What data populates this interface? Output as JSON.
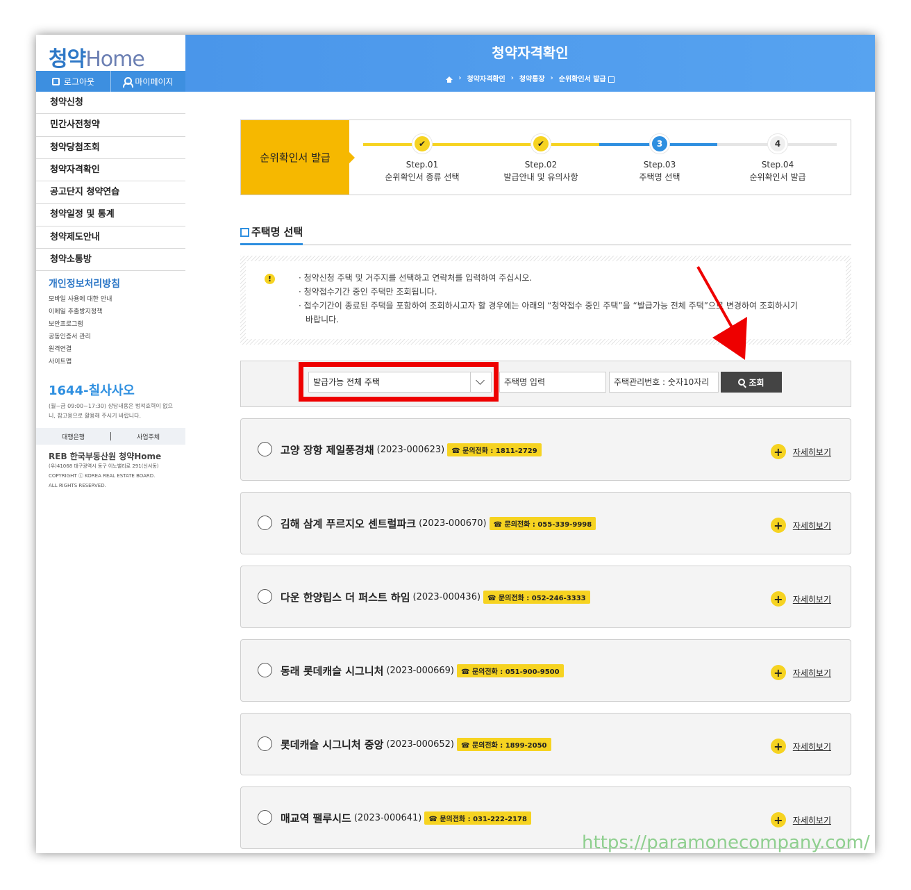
{
  "sidebar": {
    "logo_a": "청약",
    "logo_b": "Home",
    "logout": "로그아웃",
    "mypage": "마이페이지",
    "menu": [
      "청약신청",
      "민간사전청약",
      "청약당첨조회",
      "청약자격확인",
      "공고단지 청약연습",
      "청약일정 및 통계",
      "청약제도안내",
      "청약소통방"
    ],
    "privacy_title": "개인정보처리방침",
    "links": [
      "모바일 사용에 대한 안내",
      "이메일 추출방지정책",
      "보안프로그램",
      "공동인증서 관리",
      "원격연결",
      "사이트맵"
    ],
    "phone": "1644-칠사사오",
    "phone_note": "(월~금 09:00~17:30) 상담내용은 법적효력이 없으니, 참고용으로 활용해 주시기 바랍니다.",
    "bank": "대행은행",
    "business": "사업주체",
    "footer_logo": "REB 한국부동산원 청약Home",
    "footer_address": "(우)41068 대구광역시 동구 이노밸리로 291(신서동)",
    "footer_copy": "COPYRIGHT ⓒ KOREA REAL ESTATE BOARD.",
    "footer_rights": "ALL RIGHTS RESERVED."
  },
  "header": {
    "title": "청약자격확인",
    "crumbs": [
      "청약자격확인",
      "청약통장",
      "순위확인서 발급"
    ]
  },
  "steps": {
    "title": "순위확인서 발급",
    "items": [
      {
        "num": "Step.01",
        "label": "순위확인서 종류 선택",
        "state": "done"
      },
      {
        "num": "Step.02",
        "label": "발급안내 및 유의사항",
        "state": "done"
      },
      {
        "num": "Step.03",
        "label": "주택명 선택",
        "state": "current",
        "mark": "3"
      },
      {
        "num": "Step.04",
        "label": "순위확인서 발급",
        "state": "todo",
        "mark": "4"
      }
    ]
  },
  "section_title": "주택명 선택",
  "notice": {
    "icon": "!",
    "lines": [
      "· 청약신청 주택 및 거주지를 선택하고 연락처를 입력하여 주십시오.",
      "· 청약접수기간 중인 주택만 조회됩니다.",
      "· 접수기간이 종료된 주택을 포함하여 조회하시고자 할 경우에는 아래의 “청약접수 중인 주택”을 “발급가능 전체 주택”으로 변경하여 조회하시기",
      "바랍니다."
    ]
  },
  "search": {
    "select_value": "발급가능 전체 주택",
    "name_placeholder": "주택명 입력",
    "number_placeholder": "주택관리번호 : 숫자10자리",
    "button": "조회"
  },
  "houses": [
    {
      "name": "고양 장항 제일풍경채",
      "code": "(2023-000623)",
      "phone": "☎ 문의전화 : 1811-2729"
    },
    {
      "name": "김해 삼계 푸르지오 센트럴파크",
      "code": "(2023-000670)",
      "phone": "☎ 문의전화 : 055-339-9998"
    },
    {
      "name": "다운 한양립스 더 퍼스트 하임",
      "code": "(2023-000436)",
      "phone": "☎ 문의전화 : 052-246-3333"
    },
    {
      "name": "동래 롯데캐슬 시그니처",
      "code": "(2023-000669)",
      "phone": "☎ 문의전화 : 051-900-9500"
    },
    {
      "name": "롯데캐슬 시그니처 중앙",
      "code": "(2023-000652)",
      "phone": "☎ 문의전화 : 1899-2050"
    },
    {
      "name": "매교역 팰루시드",
      "code": "(2023-000641)",
      "phone": "☎ 문의전화 : 031-222-2178"
    }
  ],
  "more_label": "자세히보기",
  "watermark": "https://paramonecompany.com/",
  "colors": {
    "header": "#4a96ea",
    "accent_yellow": "#f6d321",
    "step_orange": "#f6b800",
    "highlight_red": "#ee0000"
  }
}
